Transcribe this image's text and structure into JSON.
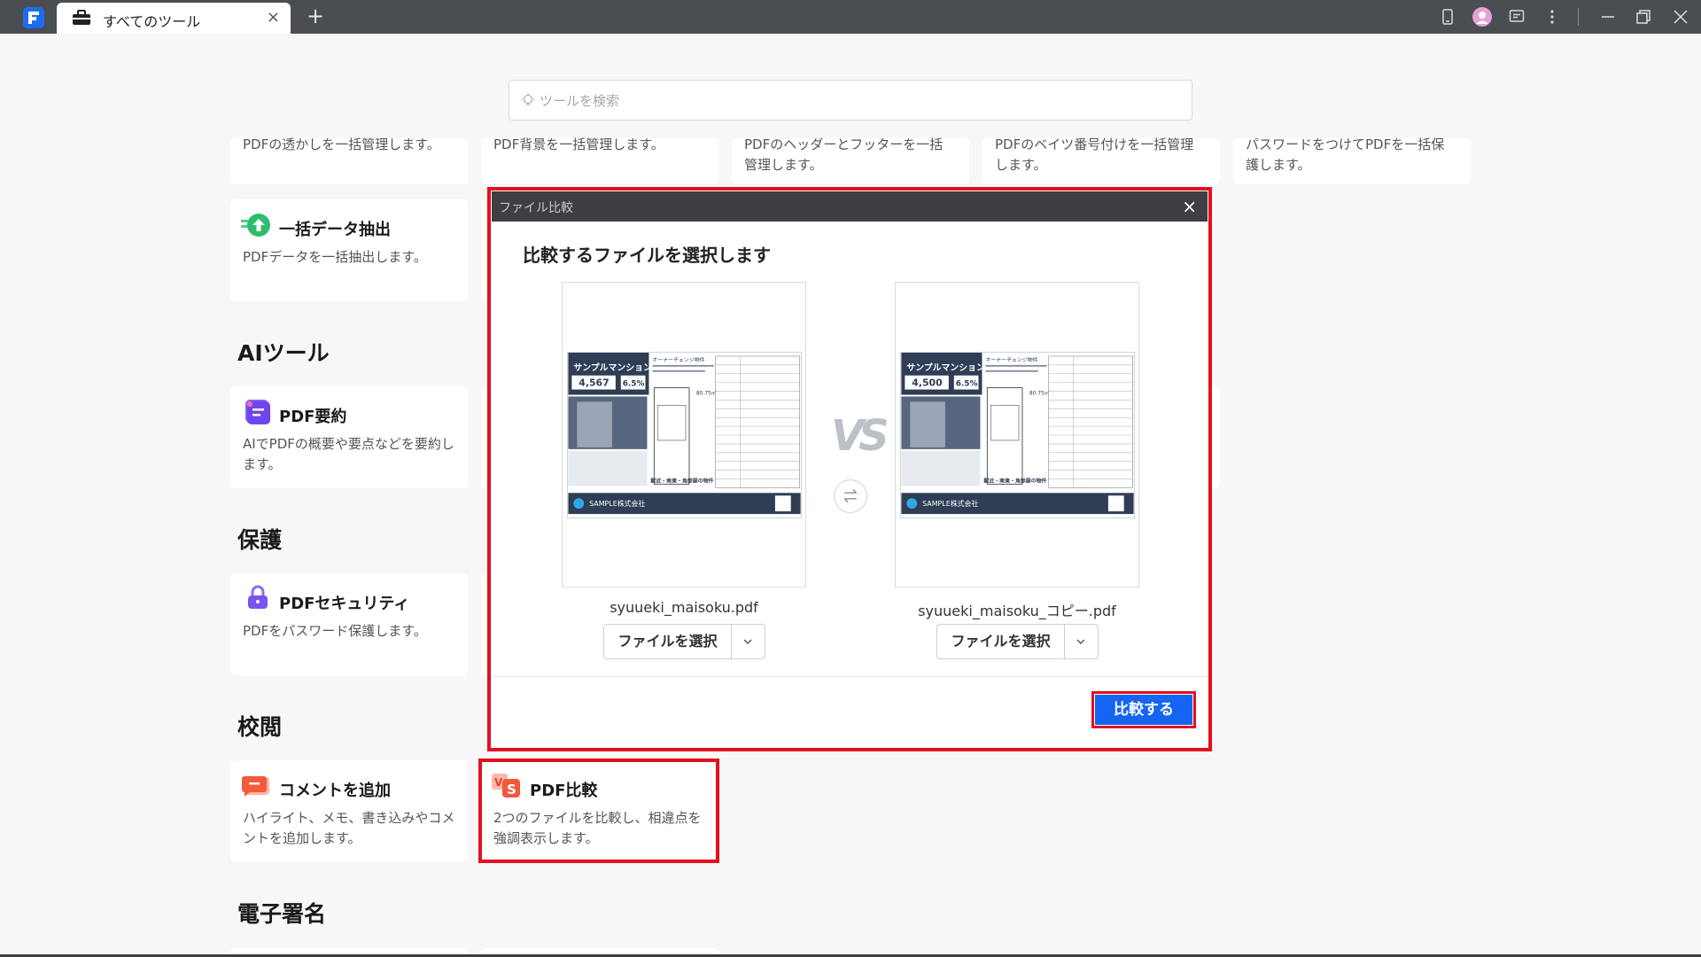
{
  "tab": {
    "title": "すべてのツール",
    "close": "×",
    "new": "+"
  },
  "search": {
    "placeholder": "ツールを検索"
  },
  "top_row": [
    {
      "desc": "PDFの透かしを一括管理します。"
    },
    {
      "desc": "PDF背景を一括管理します。"
    },
    {
      "desc": "PDFのヘッダーとフッターを一括管理します。"
    },
    {
      "desc": "PDFのベイツ番号付けを一括管理します。"
    },
    {
      "desc": "パスワードをつけてPDFを一括保護します。"
    }
  ],
  "batch_extract": {
    "title": "一括データ抽出",
    "desc": "PDFデータを一括抽出します。"
  },
  "sections": {
    "ai": "AIツール",
    "protect": "保護",
    "review": "校閲",
    "esign": "電子署名"
  },
  "cards": {
    "summary": {
      "title": "PDF要約",
      "desc": "AIでPDFの概要や要点などを要約します。"
    },
    "security": {
      "title": "PDFセキュリティ",
      "desc": "PDFをパスワード保護します。"
    },
    "comment": {
      "title": "コメントを追加",
      "desc": "ハイライト、メモ、書き込みやコメントを追加します。"
    },
    "compare": {
      "title": "PDF比較",
      "desc": "2つのファイルを比較し、相違点を強調表示します。"
    }
  },
  "modal": {
    "title": "ファイル比較",
    "close": "×",
    "heading": "比較するファイルを選択します",
    "vs": "VS",
    "left_file": {
      "name": "syuueki_maisoku.pdf",
      "select_label": "ファイルを選択",
      "price": "4,567"
    },
    "right_file": {
      "name": "syuueki_maisoku_コピー.pdf",
      "select_label": "ファイルを選択",
      "price": "4,500"
    },
    "doc": {
      "building_name": "サンプルマンション",
      "rate": "6.5%",
      "headline": "オーナーチェンジ物件",
      "tagline": "駅近・南東・角部屋の物件",
      "company": "SAMPLE株式会社",
      "area": "80.75㎡"
    },
    "compare_button": "比較する"
  },
  "colors": {
    "accent": "#1565f2",
    "highlight": "#e3101e",
    "titlebar": "#4a4d52"
  }
}
